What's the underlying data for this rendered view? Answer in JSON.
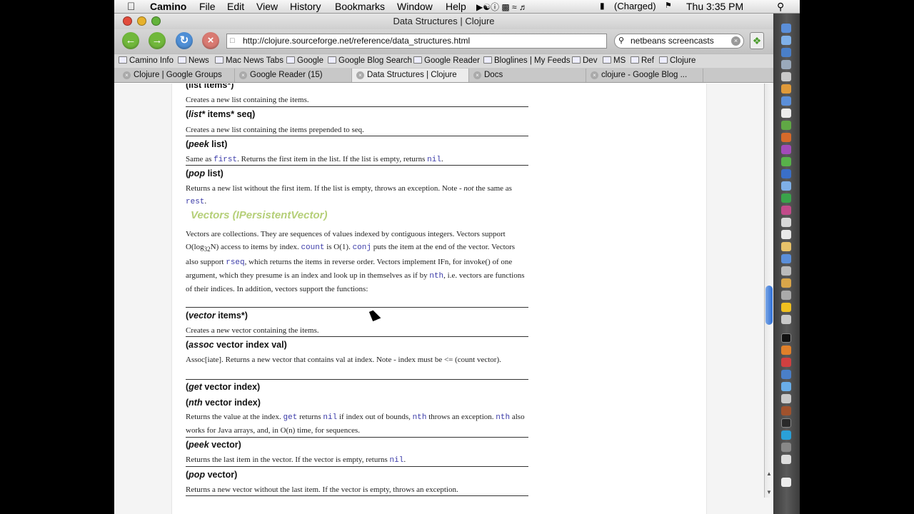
{
  "menubar": {
    "app": "Camino",
    "items": [
      "File",
      "Edit",
      "View",
      "History",
      "Bookmarks",
      "Window",
      "Help"
    ],
    "battery": "(Charged)",
    "clock": "Thu 3:35 PM"
  },
  "window": {
    "title": "Data Structures | Clojure"
  },
  "toolbar": {
    "url": "http://clojure.sourceforge.net/reference/data_structures.html",
    "search": "netbeans screencasts"
  },
  "bookmarks": [
    "Camino Info",
    "News",
    "Mac News Tabs",
    "Google",
    "Google Blog Search",
    "Google Reader",
    "Bloglines | My Feeds",
    "Dev",
    "MS",
    "Ref",
    "Clojure"
  ],
  "tabs": [
    "Clojure | Google Groups",
    "Google Reader (15)",
    "Data Structures | Clojure",
    "Docs",
    "clojure - Google Blog ..."
  ],
  "page": {
    "partial_head": "(list items*)",
    "list_star": {
      "fn": "list*",
      "args": " items* seq)",
      "desc": "Creates a new list containing the items prepended to seq."
    },
    "list_desc": "Creates a new list containing the items.",
    "peek_list": {
      "fn": "peek",
      "args": " list)",
      "pre": "Same as ",
      "code1": "first",
      "mid": ". Returns the first item in the list. If the list is empty, returns ",
      "code2": "nil",
      "post": "."
    },
    "pop_list": {
      "fn": "pop",
      "args": " list)",
      "pre": "Returns a new list without the first item. If the list is empty, throws an exception. Note - ",
      "em": "not",
      "mid": " the same as ",
      "code1": "rest",
      "post": "."
    },
    "section": "Vectors (IPersistentVector)",
    "vec_intro": {
      "t1": "Vectors are collections. They are sequences of values indexed by contiguous integers. Vectors support O(log",
      "sub": "32",
      "t2": "N) access to items by index. ",
      "c1": "count",
      "t3": " is O(1). ",
      "c2": "conj",
      "t4": " puts the item at the end of the vector. Vectors also support ",
      "c3": "rseq",
      "t5": ", which returns the items in reverse order. Vectors implement IFn, for invoke() of one argument, which they presume is an index and look up in themselves as if by ",
      "c4": "nth",
      "t6": ", i.e. vectors are functions of their indices. In addition, vectors support the functions:"
    },
    "vector": {
      "fn": "vector",
      "args": " items*)",
      "desc": "Creates a new vector containing the items."
    },
    "assoc": {
      "fn": "assoc",
      "args": " vector index val)",
      "desc": "Assoc[iate]. Returns a new vector that contains val at index. Note - index must be <= (count vector)."
    },
    "get": {
      "fn": "get",
      "args": " vector index)"
    },
    "nth": {
      "fn": "nth",
      "args": " vector index)",
      "t1": "Returns the value at the index. ",
      "c1": "get",
      "t2": " returns ",
      "c2": "nil",
      "t3": " if index out of bounds, ",
      "c3": "nth",
      "t4": " throws an exception. ",
      "c4": "nth",
      "t5": " also works for Java arrays, and, in O(n) time, for sequences."
    },
    "peek_vec": {
      "fn": "peek",
      "args": " vector)",
      "t1": "Returns the last item in the vector. If the vector is empty, returns ",
      "c1": "nil",
      "t2": "."
    },
    "pop_vec": {
      "fn": "pop",
      "args": " vector)",
      "desc": "Returns a new vector without the last item. If the vector is empty, throws an exception."
    }
  }
}
